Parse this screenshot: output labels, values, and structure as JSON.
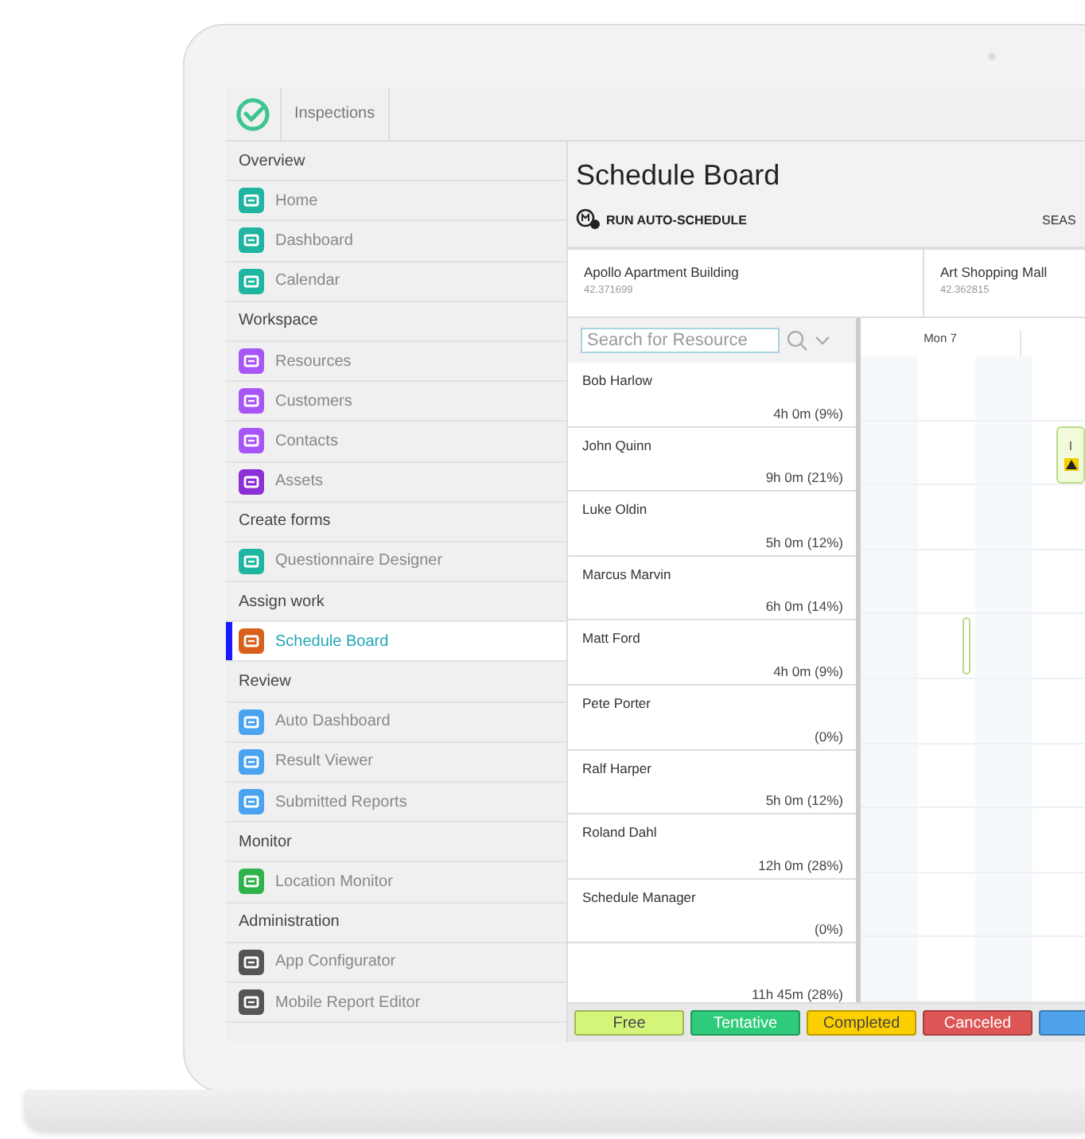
{
  "app_tab": {
    "label": "Inspections"
  },
  "sidebar": {
    "items": [
      {
        "kind": "section",
        "label": "Overview"
      },
      {
        "kind": "item",
        "label": "Home",
        "color": "#1fb5a0",
        "selected": false
      },
      {
        "kind": "item",
        "label": "Dashboard",
        "color": "#1fb5a0",
        "selected": false
      },
      {
        "kind": "item",
        "label": "Calendar",
        "color": "#1fb5a0",
        "selected": false
      },
      {
        "kind": "section",
        "label": "Workspace"
      },
      {
        "kind": "item",
        "label": "Resources",
        "color": "#a855f7",
        "selected": false
      },
      {
        "kind": "item",
        "label": "Customers",
        "color": "#a855f7",
        "selected": false
      },
      {
        "kind": "item",
        "label": "Contacts",
        "color": "#a855f7",
        "selected": false
      },
      {
        "kind": "item",
        "label": "Assets",
        "color": "#8b2fd6",
        "selected": false
      },
      {
        "kind": "section",
        "label": "Create forms"
      },
      {
        "kind": "item",
        "label": "Questionnaire Designer",
        "color": "#1fb5a0",
        "selected": false
      },
      {
        "kind": "section",
        "label": "Assign work"
      },
      {
        "kind": "item",
        "label": "Schedule Board",
        "color": "#d9601a",
        "selected": true
      },
      {
        "kind": "section",
        "label": "Review"
      },
      {
        "kind": "item",
        "label": "Auto Dashboard",
        "color": "#4aa3f0",
        "selected": false
      },
      {
        "kind": "item",
        "label": "Result Viewer",
        "color": "#4aa3f0",
        "selected": false
      },
      {
        "kind": "item",
        "label": "Submitted Reports",
        "color": "#4aa3f0",
        "selected": false
      },
      {
        "kind": "section",
        "label": "Monitor"
      },
      {
        "kind": "item",
        "label": "Location Monitor",
        "color": "#2fb34a",
        "selected": false
      },
      {
        "kind": "section",
        "label": "Administration"
      },
      {
        "kind": "item",
        "label": "App Configurator",
        "color": "#555555",
        "selected": false
      },
      {
        "kind": "item",
        "label": "Mobile Report Editor",
        "color": "#555555",
        "selected": false
      }
    ]
  },
  "main": {
    "title": "Schedule Board",
    "toolbar": {
      "action": "RUN AUTO-SCHEDULE",
      "right_label": "SEAS"
    },
    "sites": [
      {
        "name": "Apollo Apartment Building",
        "code": "42.371699"
      },
      {
        "name": "Art Shopping Mall",
        "code": "42.362815"
      }
    ],
    "search": {
      "placeholder": "Search for Resource"
    },
    "day_label": "Mon 7",
    "resources": [
      {
        "name": "Bob Harlow",
        "hours": "4h 0m (9%)"
      },
      {
        "name": "John Quinn",
        "hours": "9h 0m (21%)",
        "event": {
          "kind": "warning",
          "text": "I"
        }
      },
      {
        "name": "Luke Oldin",
        "hours": "5h 0m (12%)"
      },
      {
        "name": "Marcus Marvin",
        "hours": "6h 0m (14%)"
      },
      {
        "name": "Matt Ford",
        "hours": "4h 0m (9%)",
        "event": {
          "kind": "plain"
        }
      },
      {
        "name": "Pete Porter",
        "hours": "(0%)"
      },
      {
        "name": "Ralf Harper",
        "hours": "5h 0m (12%)"
      },
      {
        "name": "Roland Dahl",
        "hours": "12h 0m (28%)"
      },
      {
        "name": "Schedule Manager",
        "hours": "(0%)"
      },
      {
        "hours": "11h 45m (28%)"
      }
    ],
    "legend": [
      {
        "label": "Free",
        "color": "#d4f57a"
      },
      {
        "label": "Tentative",
        "color": "#2ecc7a"
      },
      {
        "label": "Completed",
        "color": "#fcd000"
      },
      {
        "label": "Canceled",
        "color": "#dd5555"
      },
      {
        "color": "#4ea3ea"
      }
    ]
  }
}
